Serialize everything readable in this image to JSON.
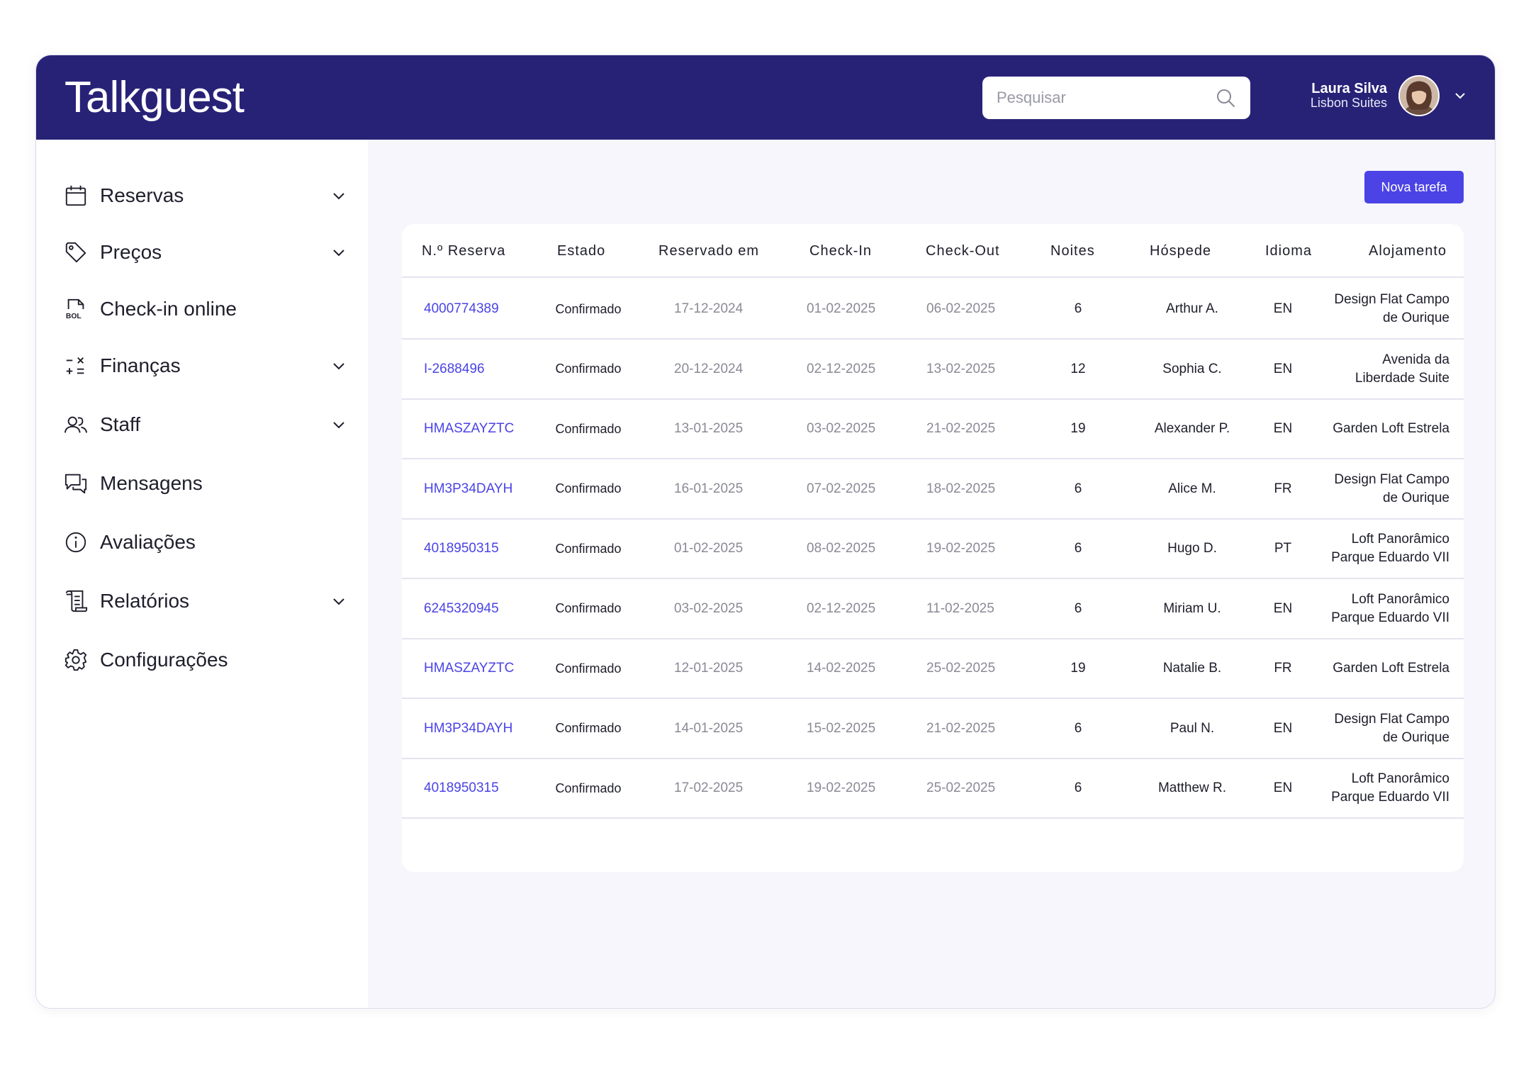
{
  "header": {
    "logo": "Talkguest",
    "search_placeholder": "Pesquisar",
    "user_name": "Laura Silva",
    "user_org": "Lisbon Suites"
  },
  "sidebar": {
    "items": [
      {
        "label": "Reservas",
        "icon": "calendar-icon",
        "expandable": true
      },
      {
        "label": "Preços",
        "icon": "tag-icon",
        "expandable": true
      },
      {
        "label": "Check-in online",
        "icon": "bol-document-icon",
        "expandable": false
      },
      {
        "label": "Finanças",
        "icon": "calculator-icon",
        "expandable": true
      },
      {
        "label": "Staff",
        "icon": "users-icon",
        "expandable": true
      },
      {
        "label": "Mensagens",
        "icon": "chat-icon",
        "expandable": false
      },
      {
        "label": "Avaliações",
        "icon": "info-icon",
        "expandable": false
      },
      {
        "label": "Relatórios",
        "icon": "scroll-icon",
        "expandable": true
      },
      {
        "label": "Configurações",
        "icon": "gear-icon",
        "expandable": false
      }
    ]
  },
  "main": {
    "new_task_label": "Nova tarefa",
    "table": {
      "columns": [
        "N.º Reserva",
        "Estado",
        "Reservado em",
        "Check-In",
        "Check-Out",
        "Noites",
        "Hóspede",
        "Idioma",
        "Alojamento"
      ],
      "rows": [
        {
          "id": "4000774389",
          "status": "Confirmado",
          "booked": "17-12-2024",
          "checkin": "01-02-2025",
          "checkout": "06-02-2025",
          "nights": "6",
          "guest": "Arthur A.",
          "lang": "EN",
          "lodging": "Design Flat Campo de Ourique"
        },
        {
          "id": "I-2688496",
          "status": "Confirmado",
          "booked": "20-12-2024",
          "checkin": "02-12-2025",
          "checkout": "13-02-2025",
          "nights": "12",
          "guest": "Sophia C.",
          "lang": "EN",
          "lodging": "Avenida da Liberdade Suite"
        },
        {
          "id": "HMASZAYZTC",
          "status": "Confirmado",
          "booked": "13-01-2025",
          "checkin": "03-02-2025",
          "checkout": "21-02-2025",
          "nights": "19",
          "guest": "Alexander P.",
          "lang": "EN",
          "lodging": "Garden Loft Estrela"
        },
        {
          "id": "HM3P34DAYH",
          "status": "Confirmado",
          "booked": "16-01-2025",
          "checkin": "07-02-2025",
          "checkout": "18-02-2025",
          "nights": "6",
          "guest": "Alice M.",
          "lang": "FR",
          "lodging": "Design Flat Campo de Ourique"
        },
        {
          "id": "4018950315",
          "status": "Confirmado",
          "booked": "01-02-2025",
          "checkin": "08-02-2025",
          "checkout": "19-02-2025",
          "nights": "6",
          "guest": "Hugo D.",
          "lang": "PT",
          "lodging": "Loft Panorâmico Parque Eduardo VII"
        },
        {
          "id": "6245320945",
          "status": "Confirmado",
          "booked": "03-02-2025",
          "checkin": "02-12-2025",
          "checkout": "11-02-2025",
          "nights": "6",
          "guest": "Miriam U.",
          "lang": "EN",
          "lodging": "Loft Panorâmico Parque Eduardo VII"
        },
        {
          "id": "HMASZAYZTC",
          "status": "Confirmado",
          "booked": "12-01-2025",
          "checkin": "14-02-2025",
          "checkout": "25-02-2025",
          "nights": "19",
          "guest": "Natalie B.",
          "lang": "FR",
          "lodging": "Garden Loft Estrela"
        },
        {
          "id": "HM3P34DAYH",
          "status": "Confirmado",
          "booked": "14-01-2025",
          "checkin": "15-02-2025",
          "checkout": "21-02-2025",
          "nights": "6",
          "guest": "Paul N.",
          "lang": "EN",
          "lodging": "Design Flat Campo de Ourique"
        },
        {
          "id": "4018950315",
          "status": "Confirmado",
          "booked": "17-02-2025",
          "checkin": "19-02-2025",
          "checkout": "25-02-2025",
          "nights": "6",
          "guest": "Matthew R.",
          "lang": "EN",
          "lodging": "Loft Panorâmico Parque Eduardo VII"
        }
      ]
    }
  },
  "colors": {
    "header_bg": "#282277",
    "accent": "#4b43e6",
    "page_bg": "#f6f6fc"
  }
}
